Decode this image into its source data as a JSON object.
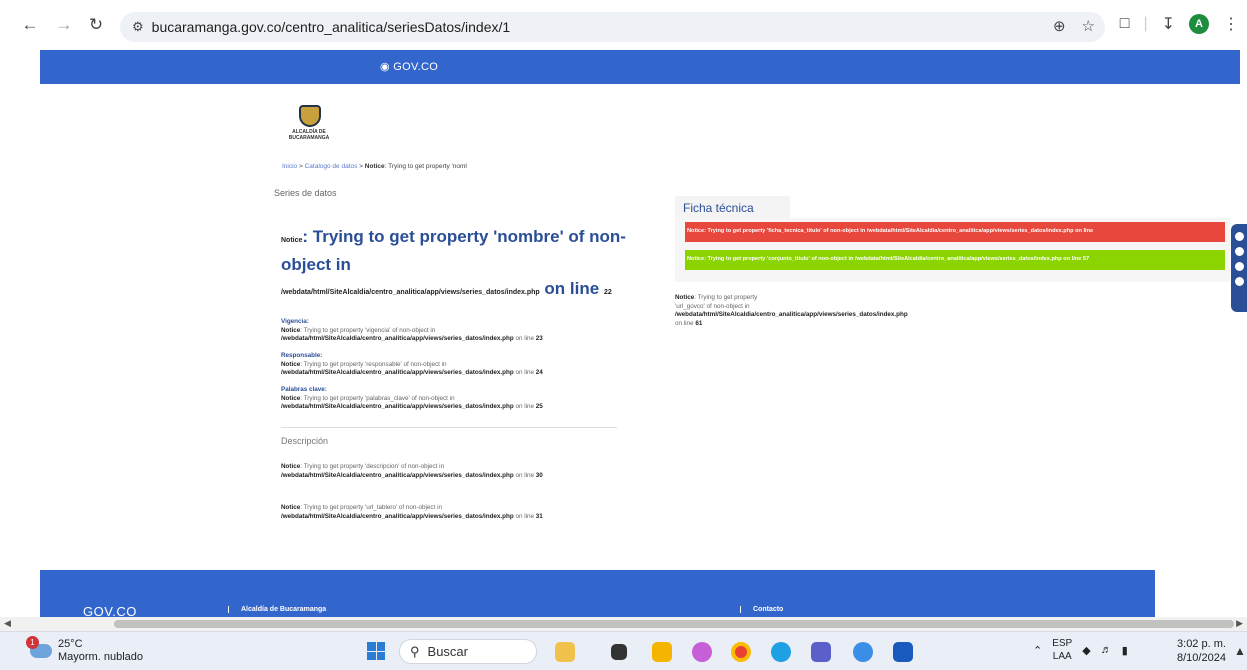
{
  "browser": {
    "url": "bucaramanga.gov.co/centro_analitica/seriesDatos/index/1",
    "avatar_letter": "A"
  },
  "govbar": {
    "logo_text": "GOV.CO"
  },
  "crest": {
    "caption_line1": "ALCALDÍA DE",
    "caption_line2": "BUCARAMANGA"
  },
  "breadcrumb": {
    "home": "Inicio",
    "sep1": " > ",
    "catalog": "Catalogo de datos",
    "sep2": " > ",
    "notice_label": "Notice",
    "notice_text": ": Trying to get property 'noml"
  },
  "series_label": "Series de datos",
  "title": {
    "notice_small": "Notice",
    "message": ": Trying to get property 'nombre' of non-object in",
    "path": "/webdata/html/SiteAlcaldia/centro_analitica/app/views/series_datos/index.php",
    "on_line": " on line ",
    "line_num": "22"
  },
  "fields": [
    {
      "label": "Vigencia:",
      "prop": "'vigencia'",
      "line": "23"
    },
    {
      "label": "Responsable:",
      "prop": "'responsable'",
      "line": "24"
    },
    {
      "label": "Palabras clave:",
      "prop": "'palabras_clave'",
      "line": "25"
    }
  ],
  "common": {
    "notice": "Notice",
    "trying": ": Trying to get property ",
    "nonobj": " of non-object in",
    "path": "/webdata/html/SiteAlcaldia/centro_analitica/app/views/series_datos/index.php",
    "on_line": " on line "
  },
  "description_label": "Descripción",
  "desc_notices": [
    {
      "prop": "'descripcion'",
      "line": "30"
    },
    {
      "prop": "'url_tablero'",
      "line": "31"
    }
  ],
  "ficha": {
    "title": "Ficha técnica",
    "red_text": "Notice: Trying to get property 'ficha_tecnica_titulo' of non-object in /webdata/html/SiteAlcaldia/centro_analitica/app/views/series_datos/index.php on line",
    "green_text": "Notice: Trying to get property 'conjunto_titulo' of non-object in /webdata/html/SiteAlcaldia/centro_analitica/app/views/series_datos/index.php on line 57",
    "url_notice_a": "Notice",
    "url_notice_b": ": Trying to get property",
    "url_notice_c": "'url_govco' of non-object in",
    "url_notice_path": "/webdata/html/SiteAlcaldia/centro_analitica/app/views/series_datos/index.php",
    "url_notice_line_label": "on line ",
    "url_notice_line": "61"
  },
  "footer": {
    "logo": "GOV.CO",
    "col1": "Alcaldía de Bucaramanga",
    "col2": "Contacto"
  },
  "taskbar": {
    "notification_count": "1",
    "temp": "25°C",
    "weather": "Mayorm. nublado",
    "search_placeholder": "Buscar",
    "lang1": "ESP",
    "lang2": "LAA",
    "time": "3:02 p. m.",
    "date": "8/10/2024"
  }
}
